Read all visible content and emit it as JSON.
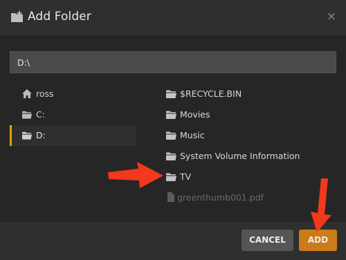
{
  "dialog": {
    "title": "Add Folder",
    "close_symbol": "×",
    "icons": {
      "title": "folder-add-icon",
      "close": "close-icon"
    }
  },
  "path": {
    "value": "D:\\"
  },
  "drives": [
    {
      "label": "ross",
      "icon": "home-icon",
      "selected": false
    },
    {
      "label": "C:",
      "icon": "folder-icon",
      "selected": false
    },
    {
      "label": "D:",
      "icon": "folder-icon",
      "selected": true
    }
  ],
  "folders": [
    {
      "label": "$RECYCLE.BIN",
      "icon": "folder-icon",
      "kind": "folder"
    },
    {
      "label": "Movies",
      "icon": "folder-icon",
      "kind": "folder"
    },
    {
      "label": "Music",
      "icon": "folder-icon",
      "kind": "folder"
    },
    {
      "label": "System Volume Information",
      "icon": "folder-icon",
      "kind": "folder"
    },
    {
      "label": "TV",
      "icon": "folder-icon",
      "kind": "folder"
    },
    {
      "label": "greenthumb001.pdf",
      "icon": "file-icon",
      "kind": "file"
    }
  ],
  "footer": {
    "cancel_label": "CANCEL",
    "add_label": "ADD"
  },
  "colors": {
    "accent": "#e5a00d",
    "add_button": "#cc7b19",
    "annotation_arrow": "#f2391c",
    "background": "#262626"
  }
}
